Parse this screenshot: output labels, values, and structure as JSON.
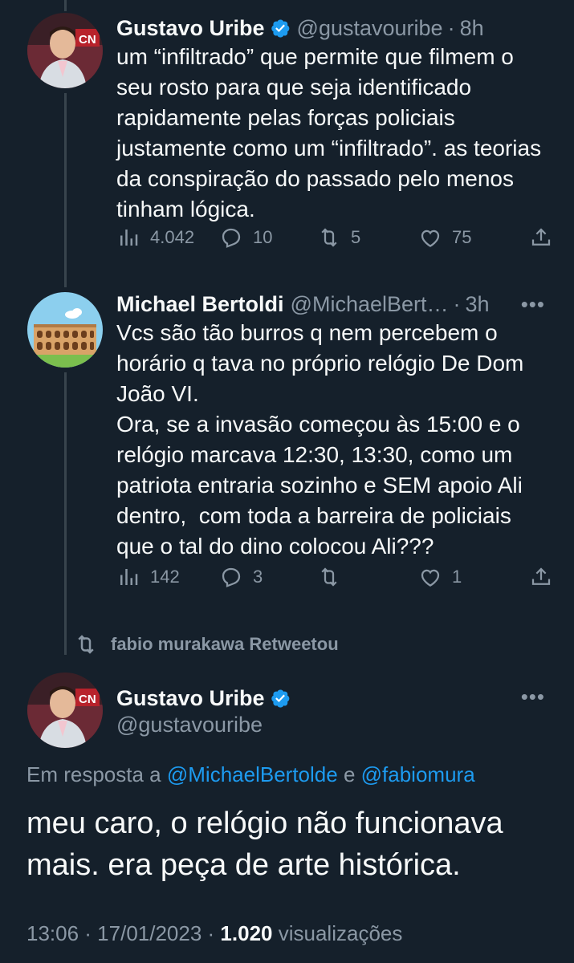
{
  "tweets": [
    {
      "author_name": "Gustavo Uribe",
      "handle": "@gustavouribe",
      "separator": "·",
      "time": "8h",
      "text": "um “infiltrado” que permite que filmem o seu rosto para que seja identificado rapidamente pelas forças policiais justamente como um “infiltrado”. as teorias da conspiração do passado pelo menos tinham lógica.",
      "views": "4.042",
      "replies": "10",
      "retweets": "5",
      "likes": "75"
    },
    {
      "author_name": "Michael Bertoldi",
      "handle": "@MichaelBert…",
      "separator": "·",
      "time": "3h",
      "more": "•••",
      "text": "Vcs são tão burros q nem percebem o horário q tava no próprio relógio De Dom João VI.\nOra, se a invasão começou às 15:00 e o relógio marcava 12:30, 13:30, como um patriota entraria sozinho e SEM apoio Ali dentro,  com toda a barreira de policiais que o tal do dino colocou Ali???",
      "views": "142",
      "replies": "3",
      "retweets": "",
      "likes": "1"
    }
  ],
  "retweet_context": "fabio murakawa Retweetou",
  "main_tweet": {
    "author_name": "Gustavo Uribe",
    "handle": "@gustavouribe",
    "more": "•••",
    "reply_prefix": "Em resposta a",
    "reply_mention_1": "@MichaelBertolde",
    "reply_conjunction": "e",
    "reply_mention_2": "@fabiomura",
    "text": "meu caro, o relógio não funcionava mais. era peça de arte histórica.",
    "timestamp": "13:06 · 17/01/2023 ·",
    "views_count": "1.020",
    "views_label": "visualizações"
  },
  "colors": {
    "background": "#15202b",
    "text": "#f7f9f9",
    "secondary": "#8b98a5",
    "accent": "#1d9bf0"
  },
  "icons": [
    "verified-badge-icon",
    "views-icon",
    "reply-icon",
    "retweet-icon",
    "like-icon",
    "share-icon",
    "more-icon"
  ]
}
